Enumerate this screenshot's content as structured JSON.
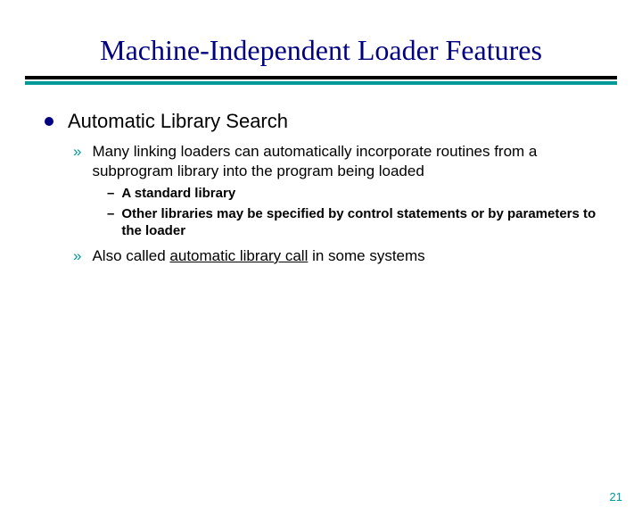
{
  "title": "Machine-Independent Loader Features",
  "bullets": {
    "l1_0": "Automatic Library Search",
    "l2_0": "Many linking loaders can automatically incorporate routines from a subprogram library into the program being loaded",
    "l3_0": "A standard library",
    "l3_1": "Other libraries may be specified by control statements or by parameters to the loader",
    "l2_1_prefix": "Also called ",
    "l2_1_underline": "automatic library call",
    "l2_1_suffix": " in some systems"
  },
  "markers": {
    "l2": "»",
    "l3": "–"
  },
  "page_number": "21"
}
